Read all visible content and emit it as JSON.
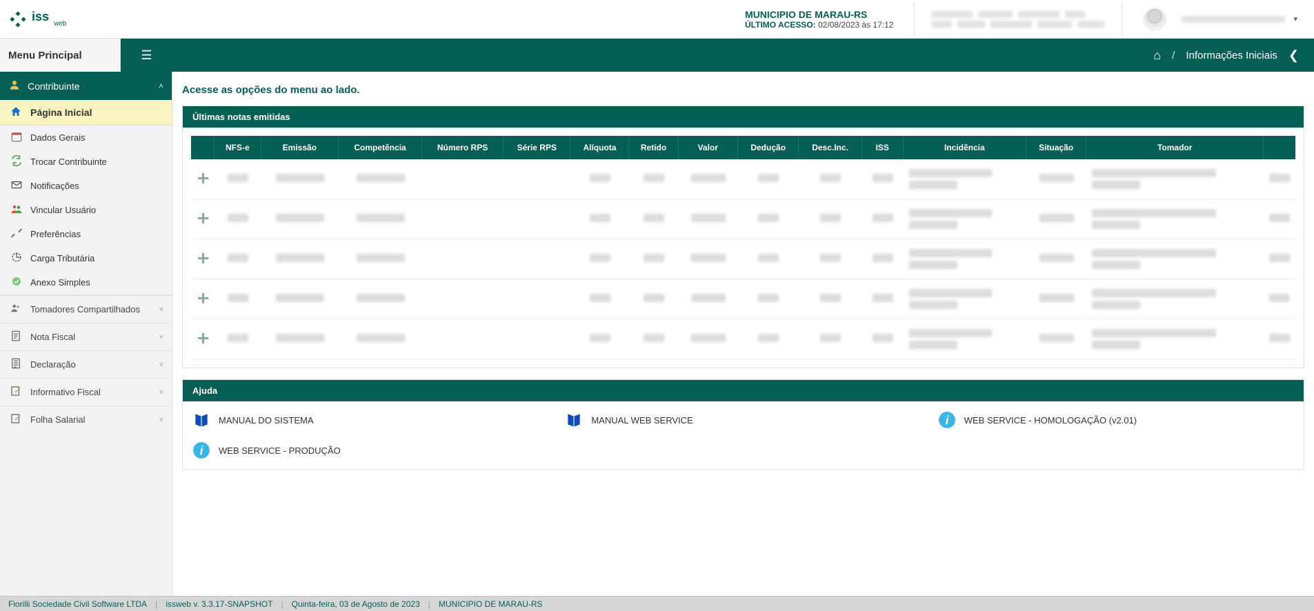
{
  "logo": {
    "title": "iss",
    "sub": "web"
  },
  "header": {
    "municipio": "MUNICIPIO DE MARAU-RS",
    "last_access_label": "ÚLTIMO ACESSO:",
    "last_access_value": "02/08/2023 às 17:12"
  },
  "breadcrumb": {
    "menu_title": "Menu Principal",
    "page": "Informações Iniciais"
  },
  "sidebar": {
    "section_contribuinte": "Contribuinte",
    "items": [
      {
        "label": "Página Inicial"
      },
      {
        "label": "Dados Gerais"
      },
      {
        "label": "Trocar Contribuinte"
      },
      {
        "label": "Notificações"
      },
      {
        "label": "Vincular Usuário"
      },
      {
        "label": "Preferências"
      },
      {
        "label": "Carga Tributária"
      },
      {
        "label": "Anexo Simples"
      }
    ],
    "collapsed": [
      {
        "label": "Tomadores Compartilhados"
      },
      {
        "label": "Nota Fiscal"
      },
      {
        "label": "Declaração"
      },
      {
        "label": "Informativo Fiscal"
      },
      {
        "label": "Folha Salarial"
      }
    ]
  },
  "main": {
    "hint": "Acesse as opções do menu ao lado.",
    "panel_notas_title": "Últimas notas emitidas",
    "table_headers": [
      "",
      "NFS-e",
      "Emissão",
      "Competência",
      "Número RPS",
      "Série RPS",
      "Alíquota",
      "Retido",
      "Valor",
      "Dedução",
      "Desc.Inc.",
      "ISS",
      "Incidência",
      "Situação",
      "Tomador",
      ""
    ],
    "panel_ajuda_title": "Ajuda",
    "help_links": [
      {
        "icon": "book",
        "label": "MANUAL DO SISTEMA"
      },
      {
        "icon": "book",
        "label": "MANUAL WEB SERVICE"
      },
      {
        "icon": "info",
        "label": "WEB SERVICE - HOMOLOGAÇÃO (v2.01)"
      },
      {
        "icon": "info",
        "label": "WEB SERVICE - PRODUÇÃO"
      }
    ]
  },
  "footer": {
    "company": "Fiorilli Sociedade Civil Software LTDA",
    "version": "issweb v. 3.3.17-SNAPSHOT",
    "date": "Quinta-feira, 03 de Agosto de 2023",
    "municipio": "MUNICIPIO DE MARAU-RS"
  }
}
